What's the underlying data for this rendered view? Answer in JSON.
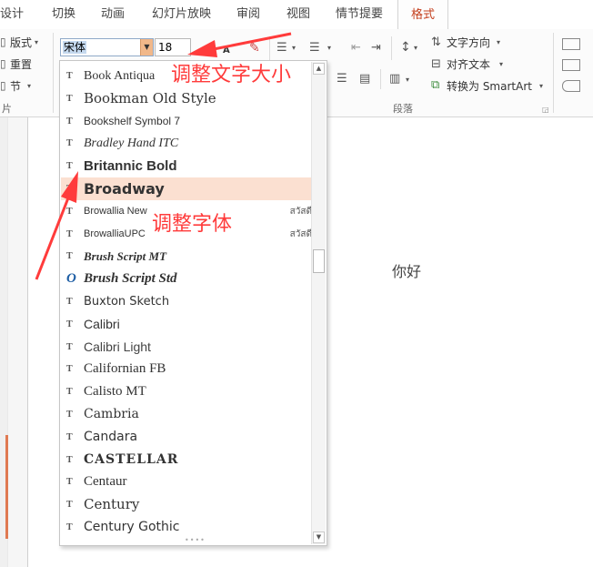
{
  "tabs": [
    {
      "label": "设计",
      "active": false
    },
    {
      "label": "切换",
      "active": false
    },
    {
      "label": "动画",
      "active": false
    },
    {
      "label": "幻灯片放映",
      "active": false
    },
    {
      "label": "审阅",
      "active": false
    },
    {
      "label": "视图",
      "active": false
    },
    {
      "label": "情节提要",
      "active": false
    },
    {
      "label": "格式",
      "active": true
    }
  ],
  "ribbon": {
    "slides_group": {
      "layout": "版式",
      "reset": "重置",
      "section": "节",
      "label": "片"
    },
    "font_name": "宋体",
    "font_size": "18",
    "grow_font": "A",
    "shrink_font": "A",
    "text_direction": "文字方向",
    "align_text": "对齐文本",
    "convert_smartart": "转换为 SmartArt",
    "paragraph_label": "段落"
  },
  "font_list": [
    {
      "name": "Book Antiqua",
      "selected": false,
      "sample": "",
      "glyph": "T"
    },
    {
      "name": "Bookman Old Style",
      "selected": false,
      "sample": "",
      "glyph": "T"
    },
    {
      "name": "Bookshelf Symbol 7",
      "selected": false,
      "sample": "",
      "glyph": "T"
    },
    {
      "name": "Bradley Hand ITC",
      "selected": false,
      "sample": "",
      "glyph": "T"
    },
    {
      "name": "Britannic Bold",
      "selected": false,
      "sample": "",
      "glyph": "T"
    },
    {
      "name": "Broadway",
      "selected": true,
      "sample": "",
      "glyph": "T"
    },
    {
      "name": "Browallia New",
      "selected": false,
      "sample": "สวัสดี",
      "glyph": "T"
    },
    {
      "name": "BrowalliaUPC",
      "selected": false,
      "sample": "สวัสดี",
      "glyph": "T"
    },
    {
      "name": "Brush Script MT",
      "selected": false,
      "sample": "",
      "glyph": "T"
    },
    {
      "name": "Brush Script Std",
      "selected": false,
      "sample": "",
      "glyph": "O"
    },
    {
      "name": "Buxton Sketch",
      "selected": false,
      "sample": "",
      "glyph": "T"
    },
    {
      "name": "Calibri",
      "selected": false,
      "sample": "",
      "glyph": "T"
    },
    {
      "name": "Calibri Light",
      "selected": false,
      "sample": "",
      "glyph": "T"
    },
    {
      "name": "Californian FB",
      "selected": false,
      "sample": "",
      "glyph": "T"
    },
    {
      "name": "Calisto MT",
      "selected": false,
      "sample": "",
      "glyph": "T"
    },
    {
      "name": "Cambria",
      "selected": false,
      "sample": "",
      "glyph": "T"
    },
    {
      "name": "Candara",
      "selected": false,
      "sample": "",
      "glyph": "T"
    },
    {
      "name": "CASTELLAR",
      "selected": false,
      "sample": "",
      "glyph": "T"
    },
    {
      "name": "Centaur",
      "selected": false,
      "sample": "",
      "glyph": "T"
    },
    {
      "name": "Century",
      "selected": false,
      "sample": "",
      "glyph": "T"
    },
    {
      "name": "Century Gothic",
      "selected": false,
      "sample": "",
      "glyph": "T"
    }
  ],
  "slide": {
    "text": "你好"
  },
  "annotations": {
    "font_size_hint": "调整文字大小",
    "font_face_hint": "调整字体"
  },
  "colors": {
    "accent": "#c43e1c",
    "annotation": "#ff3b3b",
    "selected_item": "#fbe0d1"
  }
}
